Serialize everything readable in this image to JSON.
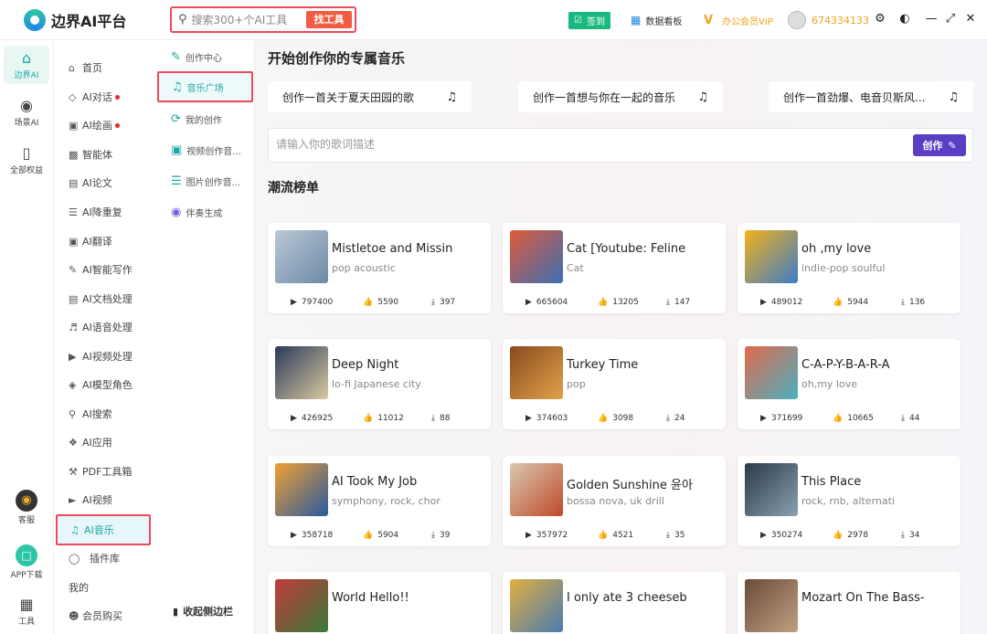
{
  "app": {
    "name": "边界AI平台"
  },
  "search": {
    "placeholder": "搜索300+个AI工具",
    "button": "找工具"
  },
  "topbar": {
    "sign": "签到",
    "dashboard": "数据看板",
    "vip": "办公会员VIP",
    "user_id": "674334133"
  },
  "rail": [
    {
      "label": "边界AI",
      "icon": "home-icon"
    },
    {
      "label": "场景AI",
      "icon": "bulb-icon"
    },
    {
      "label": "全部权益",
      "icon": "bookmark-icon"
    },
    {
      "label": "客服",
      "icon": "support-icon"
    },
    {
      "label": "APP下载",
      "icon": "phone-icon"
    },
    {
      "label": "工具",
      "icon": "grid-icon"
    }
  ],
  "menu": [
    {
      "label": "首页",
      "icon": "home-icon"
    },
    {
      "label": "AI对话",
      "icon": "cube-icon",
      "dot": true
    },
    {
      "label": "AI绘画",
      "icon": "image-icon",
      "dot": true
    },
    {
      "label": "智能体",
      "icon": "robot-icon"
    },
    {
      "label": "AI论文",
      "icon": "document-icon"
    },
    {
      "label": "AI降重复",
      "icon": "list-icon"
    },
    {
      "label": "AI翻译",
      "icon": "translate-icon"
    },
    {
      "label": "AI智能写作",
      "icon": "pen-icon"
    },
    {
      "label": "AI文档处理",
      "icon": "text-icon"
    },
    {
      "label": "AI语音处理",
      "icon": "speaker-icon"
    },
    {
      "label": "AI视频处理",
      "icon": "video-icon"
    },
    {
      "label": "AI模型角色",
      "icon": "cube-icon"
    },
    {
      "label": "AI搜索",
      "icon": "search-icon"
    },
    {
      "label": "AI应用",
      "icon": "apps-icon"
    },
    {
      "label": "PDF工具箱",
      "icon": "wrench-icon"
    },
    {
      "label": "AI视频",
      "icon": "play-icon"
    },
    {
      "label": "AI音乐",
      "icon": "music-icon"
    },
    {
      "label": "插件库",
      "icon": "plugin-icon"
    },
    {
      "label": "我的",
      "icon": ""
    },
    {
      "label": "会员购买",
      "icon": "user-icon"
    }
  ],
  "submenu": [
    {
      "label": "创作中心",
      "icon": "pen-icon"
    },
    {
      "label": "音乐广场",
      "icon": "music-icon"
    },
    {
      "label": "我的创作",
      "icon": "refresh-icon"
    },
    {
      "label": "视频创作音...",
      "icon": "video-music-icon"
    },
    {
      "label": "图片创作音...",
      "icon": "image-music-icon"
    },
    {
      "label": "伴奏生成",
      "icon": "wave-icon"
    }
  ],
  "collapse_label": "收起侧边栏",
  "main": {
    "title": "开始创作你的专属音乐",
    "prompts": [
      "创作一首关于夏天田园的歌",
      "创作一首想与你在一起的音乐",
      "创作一首劲爆、电音贝斯风..."
    ],
    "lyrics_placeholder": "请输入你的歌词描述",
    "create_label": "创作",
    "section_title": "潮流榜单"
  },
  "songs": [
    {
      "title": "Mistletoe and Missin",
      "tags": "pop acoustic",
      "plays": "797400",
      "likes": "5590",
      "downloads": "397",
      "thumb": [
        "#b9c7d6",
        "#6d8aa6"
      ]
    },
    {
      "title": "Cat [Youtube: Feline",
      "tags": "Cat",
      "plays": "665604",
      "likes": "13205",
      "downloads": "147",
      "thumb": [
        "#e05a3a",
        "#3b6fb4"
      ]
    },
    {
      "title": "oh ,my love",
      "tags": "indie-pop soulful",
      "plays": "489012",
      "likes": "5944",
      "downloads": "136",
      "thumb": [
        "#f2b21a",
        "#3d7cc9"
      ]
    },
    {
      "title": "Deep Night",
      "tags": "lo-fi Japanese city",
      "plays": "426925",
      "likes": "11012",
      "downloads": "88",
      "thumb": [
        "#2a3a5a",
        "#d9c9a0"
      ]
    },
    {
      "title": "Turkey Time",
      "tags": "pop",
      "plays": "374603",
      "likes": "3098",
      "downloads": "24",
      "thumb": [
        "#8b4a1e",
        "#e0a24a"
      ]
    },
    {
      "title": "C-A-P-Y-B-A-R-A",
      "tags": "oh,my love",
      "plays": "371699",
      "likes": "10665",
      "downloads": "44",
      "thumb": [
        "#e06a4a",
        "#4ab0c0"
      ]
    },
    {
      "title": "AI Took My Job",
      "tags": "symphony, rock, chor",
      "plays": "358718",
      "likes": "5904",
      "downloads": "39",
      "thumb": [
        "#f0a030",
        "#2a5aa0"
      ]
    },
    {
      "title": "Golden Sunshine 윤아",
      "tags": "bossa nova, uk drill",
      "plays": "357972",
      "likes": "4521",
      "downloads": "35",
      "thumb": [
        "#d8c8b0",
        "#c04a2a"
      ]
    },
    {
      "title": "This Place",
      "tags": "rock, rnb, alternati",
      "plays": "350274",
      "likes": "2978",
      "downloads": "34",
      "thumb": [
        "#2a3a4a",
        "#8aa0b0"
      ]
    },
    {
      "title": "World Hello!!",
      "tags": "",
      "plays": "",
      "likes": "",
      "downloads": "",
      "thumb": [
        "#c03a3a",
        "#3a7a3a"
      ]
    },
    {
      "title": "I only ate 3 cheeseb",
      "tags": "",
      "plays": "",
      "likes": "",
      "downloads": "",
      "thumb": [
        "#e0b040",
        "#4a7ab0"
      ]
    },
    {
      "title": "Mozart On The Bass-",
      "tags": "",
      "plays": "",
      "likes": "",
      "downloads": "",
      "thumb": [
        "#6a4a3a",
        "#c0a080"
      ]
    }
  ]
}
